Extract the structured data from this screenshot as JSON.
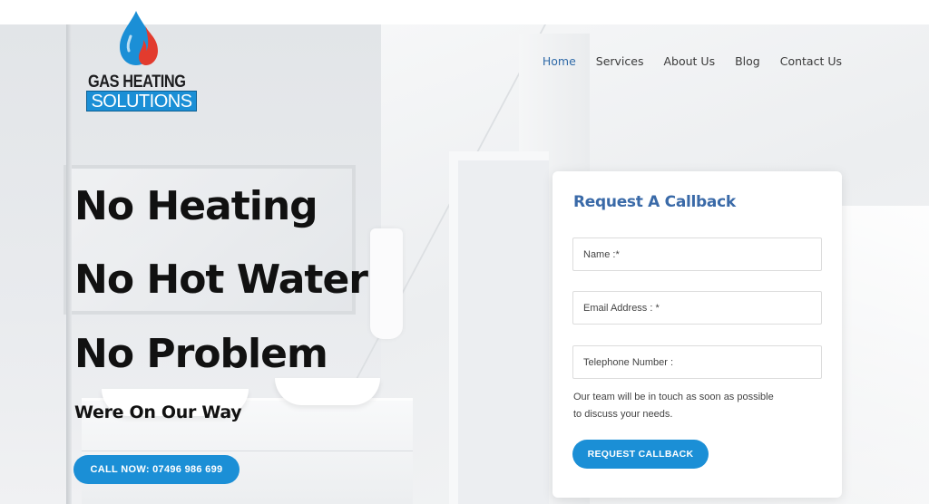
{
  "brand": {
    "logo_line1": "GAS HEATING",
    "logo_line2": "SOLUTIONS",
    "colors": {
      "accent": "#1b8fd6",
      "nav_active": "#2f6aa8",
      "flame_red": "#e23b2e",
      "drop_blue": "#1b8fd6"
    }
  },
  "nav": {
    "items": [
      {
        "label": "Home",
        "active": true
      },
      {
        "label": "Services",
        "active": false
      },
      {
        "label": "About Us",
        "active": false
      },
      {
        "label": "Blog",
        "active": false
      },
      {
        "label": "Contact Us",
        "active": false
      }
    ]
  },
  "hero": {
    "headline1": "No Heating",
    "headline2": "No Hot Water",
    "headline3": "No Problem",
    "subline": "Were On Our Way",
    "call_button": "CALL NOW: 07496 986 699"
  },
  "callback_form": {
    "title": "Request A Callback",
    "name_placeholder": "Name :*",
    "email_placeholder": "Email Address : *",
    "phone_placeholder": "Telephone Number :",
    "note": "Our team will be in touch as soon as possible to discuss your needs.",
    "submit_label": "REQUEST CALLBACK"
  },
  "icons": {
    "logo_mark": "flame-drop-icon"
  }
}
